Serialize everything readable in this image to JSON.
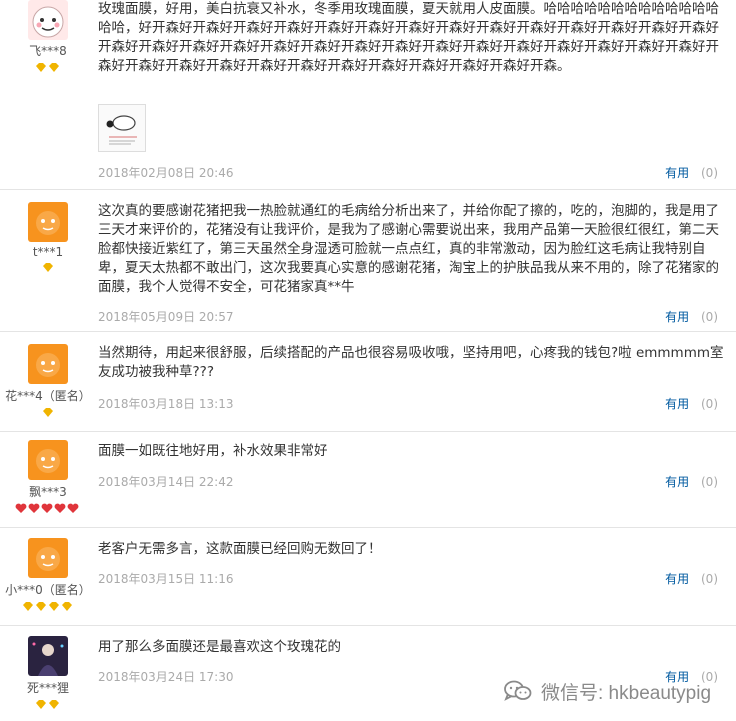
{
  "reviews": [
    {
      "username": "飞***8",
      "badge": "gold",
      "badge_count": 2,
      "content": "玫瑰面膜，好用，美白抗衰又补水，冬季用玫瑰面膜，夏天就用人皮面膜。哈哈哈哈哈哈哈哈哈哈哈哈哈哈哈，好开森好开森好开森好开森好开森好开森好开森好开森好开森好开森好开森好开森好开森好开森好开森好开森好开森好开森好开森好开森好开森好开森好开森好开森好开森好开森好开森好开森好开森好开森好开森好开森好开森好开森好开森好开森好开森好开森好开森好开森好开森。",
      "date": "2018年02月08日 20:46",
      "useful_label": "有用",
      "useful_count": "(0)",
      "has_image": true
    },
    {
      "username": "t***1",
      "badge": "gold",
      "badge_count": 1,
      "content": "这次真的要感谢花猪把我一热脸就通红的毛病给分析出来了，并给你配了擦的，吃的，泡脚的，我是用了三天才来评价的，花猪没有让我评价，是我为了感谢心需要说出来，我用产品第一天脸很红很红，第二天脸都快接近紫红了，第三天虽然全身湿透可脸就一点点红，真的非常激动，因为脸红这毛病让我特别自卑，夏天太热都不敢出门，这次我要真心实意的感谢花猪，淘宝上的护肤品我从来不用的，除了花猪家的面膜，我个人觉得不安全，可花猪家真**牛",
      "date": "2018年05月09日 20:57",
      "useful_label": "有用",
      "useful_count": "(0)",
      "has_image": false
    },
    {
      "username": "花***4（匿名）",
      "badge": "gold",
      "badge_count": 1,
      "content": "当然期待，用起来很舒服，后续搭配的产品也很容易吸收哦，坚持用吧，心疼我的钱包?啦 emmmmm室友成功被我种草???",
      "date": "2018年03月18日 13:13",
      "useful_label": "有用",
      "useful_count": "(0)",
      "has_image": false
    },
    {
      "username": "飘***3",
      "badge": "red",
      "badge_count": 5,
      "content": "面膜一如既往地好用，补水效果非常好",
      "date": "2018年03月14日 22:42",
      "useful_label": "有用",
      "useful_count": "(0)",
      "has_image": false
    },
    {
      "username": "小***0（匿名）",
      "badge": "gold",
      "badge_count": 4,
      "content": "老客户无需多言，这款面膜已经回购无数回了！",
      "date": "2018年03月15日 11:16",
      "useful_label": "有用",
      "useful_count": "(0)",
      "has_image": false
    },
    {
      "username": "死***狸",
      "badge": "gold",
      "badge_count": 2,
      "content": "用了那么多面膜还是最喜欢这个玫瑰花的",
      "date": "2018年03月24日 17:30",
      "useful_label": "有用",
      "useful_count": "(0)",
      "has_image": false
    }
  ],
  "watermark": {
    "text": "微信号: hkbeautypig",
    "icon": "wechat-icon"
  },
  "colors": {
    "link": "#005aa0",
    "meta": "#aaaaaa",
    "divider": "#e4e4e4",
    "gold_badge": "#f0b400",
    "red_badge": "#e0353b",
    "avatar_orange": "#f7931e"
  }
}
